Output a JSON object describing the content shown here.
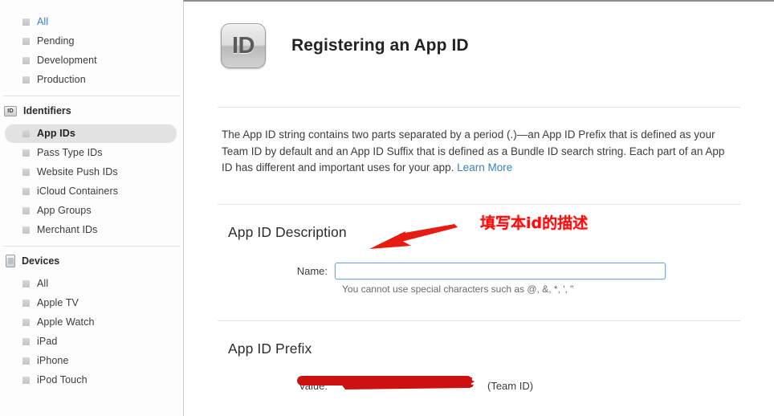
{
  "sidebar": {
    "top_items": [
      {
        "label": "All",
        "style": "link"
      },
      {
        "label": "Pending",
        "style": "normal"
      },
      {
        "label": "Development",
        "style": "normal"
      },
      {
        "label": "Production",
        "style": "normal"
      }
    ],
    "identifiers": {
      "icon": "id-badge-icon",
      "icon_text": "ID",
      "header": "Identifiers",
      "items": [
        {
          "label": "App IDs",
          "selected": true
        },
        {
          "label": "Pass Type IDs",
          "selected": false
        },
        {
          "label": "Website Push IDs",
          "selected": false
        },
        {
          "label": "iCloud Containers",
          "selected": false
        },
        {
          "label": "App Groups",
          "selected": false
        },
        {
          "label": "Merchant IDs",
          "selected": false
        }
      ]
    },
    "devices": {
      "icon": "iphone-icon",
      "header": "Devices",
      "items": [
        {
          "label": "All"
        },
        {
          "label": "Apple TV"
        },
        {
          "label": "Apple Watch"
        },
        {
          "label": "iPad"
        },
        {
          "label": "iPhone"
        },
        {
          "label": "iPod Touch"
        }
      ]
    }
  },
  "main": {
    "icon_text": "ID",
    "title": "Registering an App ID",
    "intro": {
      "body": "The App ID string contains two parts separated by a period (.)—an App ID Prefix that is defined as your Team ID by default and an App ID Suffix that is defined as a Bundle ID search string. Each part of an App ID has different and important uses for your app. ",
      "link_label": "Learn More"
    },
    "description_section": {
      "title": "App ID Description",
      "name_label": "Name:",
      "name_value": "",
      "name_placeholder": "",
      "hint": "You cannot use special characters such as @, &, *, ', \""
    },
    "prefix_section": {
      "title": "App ID Prefix",
      "value_label": "Value:",
      "value_suffix": "(Team ID)"
    }
  },
  "annotations": {
    "chinese_note": "填写本id的描述",
    "arrow": "red-arrow-icon",
    "redaction": "red-redaction-stroke",
    "colors": {
      "annotation_red": "#fb0b0b",
      "redaction_red": "#cc1111",
      "link_blue": "#3a7fc1",
      "focus_blue": "#7aa7d4"
    }
  }
}
